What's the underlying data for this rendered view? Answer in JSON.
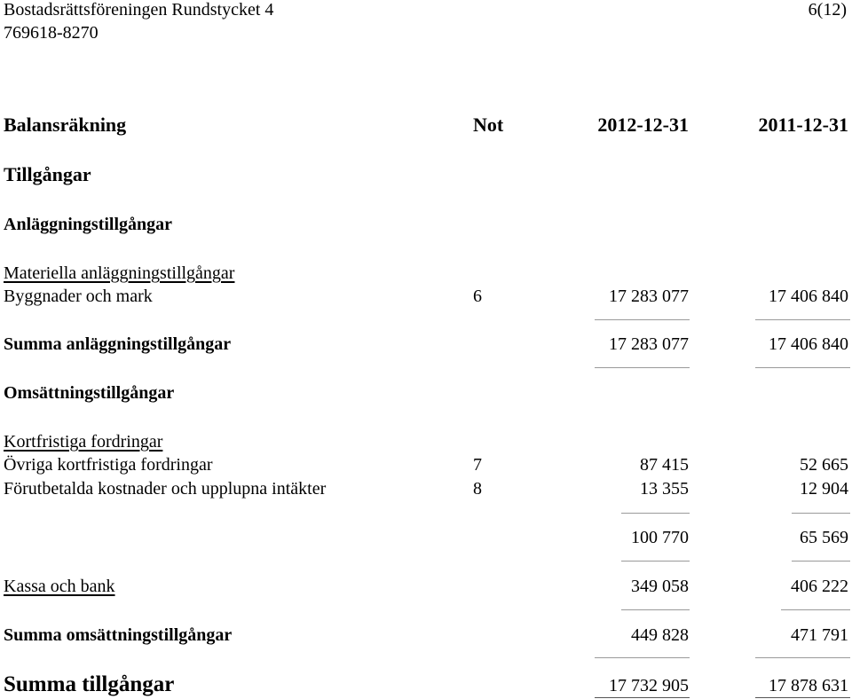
{
  "header": {
    "org_name": "Bostadsrättsföreningen Rundstycket 4",
    "org_number": "769618-8270",
    "page": "6(12)"
  },
  "report": {
    "title": "Balansräkning",
    "col_note": "Not",
    "col_current": "2012-12-31",
    "col_previous": "2011-12-31"
  },
  "sections": {
    "assets": "Tillgångar",
    "fixed_assets": "Anläggningstillgångar",
    "tangible_fixed_assets": "Materiella anläggningstillgångar",
    "current_assets": "Omsättningstillgångar",
    "short_term_receivables": "Kortfristiga fordringar",
    "cash_and_bank": "Kassa och bank"
  },
  "rows": {
    "buildings_land": {
      "label": "Byggnader och mark",
      "note": "6",
      "current": "17 283 077",
      "previous": "17 406 840"
    },
    "sum_fixed_assets": {
      "label": "Summa anläggningstillgångar",
      "current": "17 283 077",
      "previous": "17 406 840"
    },
    "other_receivables": {
      "label": "Övriga kortfristiga fordringar",
      "note": "7",
      "current": "87 415",
      "previous": "52 665"
    },
    "prepaid_accrued": {
      "label": "Förutbetalda kostnader och upplupna intäkter",
      "note": "8",
      "current": "13 355",
      "previous": "12 904"
    },
    "subtotal_receivables": {
      "current": "100 770",
      "previous": "65 569"
    },
    "cash_bank": {
      "current": "349 058",
      "previous": "406 222"
    },
    "sum_current_assets": {
      "label": "Summa omsättningstillgångar",
      "current": "449 828",
      "previous": "471 791"
    },
    "total_assets": {
      "label": "Summa tillgångar",
      "current": "17 732 905",
      "previous": "17 878 631"
    }
  }
}
